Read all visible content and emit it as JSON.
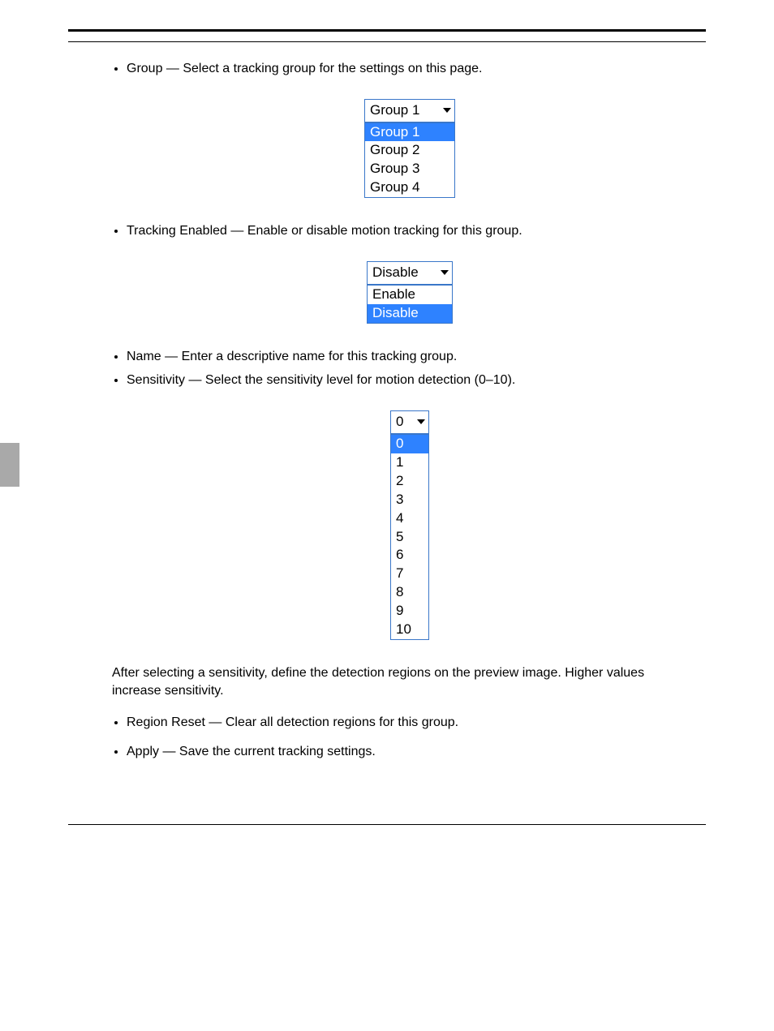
{
  "bullets": {
    "b1": {
      "label_strong": "Group",
      "label_rest": " — Select a tracking group for the settings on this page."
    },
    "b2": {
      "label_strong": "Tracking Enabled",
      "label_rest": " — Enable or disable motion tracking for this group."
    },
    "b3": {
      "label": "Name — Enter a descriptive name for this tracking group."
    },
    "b4": {
      "label_strong": "Sensitivity",
      "label_rest": " — Select the sensitivity level for motion detection (0–10)."
    },
    "b5": {
      "label_strong": "Region Reset",
      "label_rest": " — Clear all detection regions for this group."
    },
    "b6": {
      "label_strong": "Apply",
      "label_rest": " — Save the current tracking settings."
    }
  },
  "between_4_5": "After selecting a sensitivity, define the detection regions on the preview image. Higher values increase sensitivity.",
  "dd_group": {
    "selected": "Group 1",
    "options": [
      "Group 1",
      "Group 2",
      "Group 3",
      "Group 4"
    ],
    "highlighted": 0
  },
  "dd_enable": {
    "selected": "Disable",
    "options": [
      "Enable",
      "Disable"
    ],
    "highlighted": 1
  },
  "dd_sens": {
    "selected": "0",
    "options": [
      "0",
      "1",
      "2",
      "3",
      "4",
      "5",
      "6",
      "7",
      "8",
      "9",
      "10"
    ],
    "highlighted": 0
  }
}
